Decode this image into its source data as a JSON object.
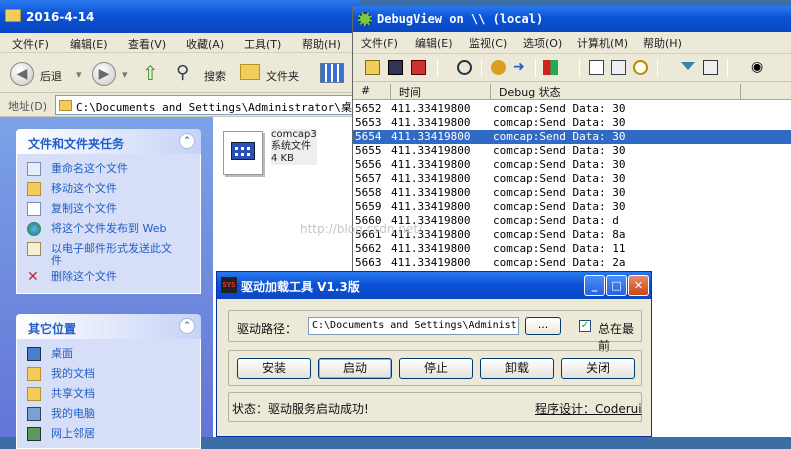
{
  "explorer": {
    "title": "2016-4-14",
    "menu": [
      "文件(F)",
      "编辑(E)",
      "查看(V)",
      "收藏(A)",
      "工具(T)",
      "帮助(H)"
    ],
    "toolbar": {
      "back": "后退",
      "search": "搜索",
      "folders": "文件夹"
    },
    "address_label": "地址(D)",
    "address_value": "C:\\Documents and Settings\\Administrator\\桌面\\",
    "tasks_panel": {
      "title": "文件和文件夹任务",
      "items": [
        "重命名这个文件",
        "移动这个文件",
        "复制这个文件",
        "将这个文件发布到 Web",
        "以电子邮件形式发送此文件",
        "删除这个文件"
      ]
    },
    "places_panel": {
      "title": "其它位置",
      "items": [
        "桌面",
        "我的文档",
        "共享文档",
        "我的电脑",
        "网上邻居"
      ]
    },
    "file": {
      "name": "comcap3",
      "type": "系统文件",
      "size": "4 KB"
    }
  },
  "debugview": {
    "title": "DebugView on \\\\          (local)",
    "menu": [
      "文件(F)",
      "编辑(E)",
      "监视(C)",
      "选项(O)",
      "计算机(M)",
      "帮助(H)"
    ],
    "columns": [
      "#",
      "时间",
      "Debug 状态"
    ],
    "rows": [
      {
        "n": "5652",
        "t": "411.33419800",
        "msg": "comcap:Send Data: 30"
      },
      {
        "n": "5653",
        "t": "411.33419800",
        "msg": "comcap:Send Data: 30"
      },
      {
        "n": "5654",
        "t": "411.33419800",
        "msg": "comcap:Send Data: 30",
        "selected": true
      },
      {
        "n": "5655",
        "t": "411.33419800",
        "msg": "comcap:Send Data: 30"
      },
      {
        "n": "5656",
        "t": "411.33419800",
        "msg": "comcap:Send Data: 30"
      },
      {
        "n": "5657",
        "t": "411.33419800",
        "msg": "comcap:Send Data: 30"
      },
      {
        "n": "5658",
        "t": "411.33419800",
        "msg": "comcap:Send Data: 30"
      },
      {
        "n": "5659",
        "t": "411.33419800",
        "msg": "comcap:Send Data: 30"
      },
      {
        "n": "5660",
        "t": "411.33419800",
        "msg": "comcap:Send Data:  d"
      },
      {
        "n": "5661",
        "t": "411.33419800",
        "msg": "comcap:Send Data: 8a"
      },
      {
        "n": "5662",
        "t": "411.33419800",
        "msg": "comcap:Send Data: 11"
      },
      {
        "n": "5663",
        "t": "411.33419800",
        "msg": "comcap:Send Data: 2a"
      }
    ]
  },
  "dialog": {
    "title": "驱动加载工具 V1.3版",
    "path_label": "驱动路径：",
    "path_value": "C:\\Documents and Settings\\Administ",
    "browse": "...",
    "always_on_top": "总在最前",
    "buttons": [
      "安装",
      "启动",
      "停止",
      "卸载",
      "关闭"
    ],
    "status": "状态：驱动服务启动成功!",
    "credit": "程序设计：Coderui"
  },
  "watermark": "http://blog.csdn.net/"
}
